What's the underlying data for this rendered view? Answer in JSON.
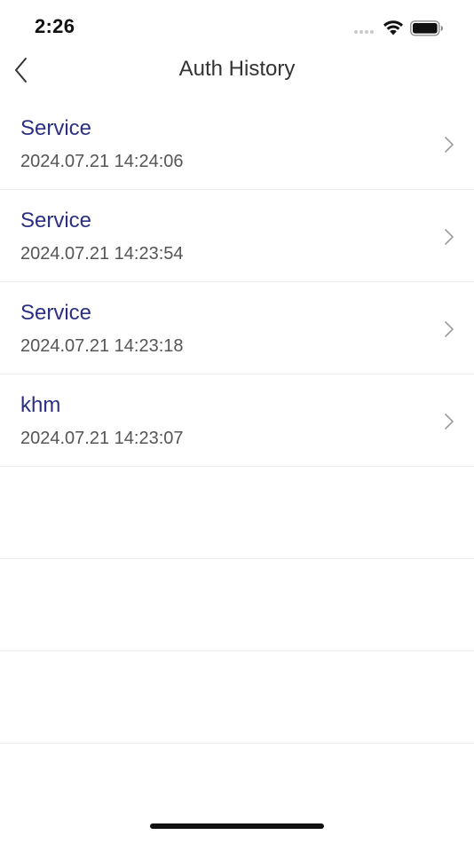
{
  "status_bar": {
    "time": "2:26"
  },
  "nav": {
    "title": "Auth History"
  },
  "history": [
    {
      "title": "Service",
      "datetime": "2024.07.21 14:24:06"
    },
    {
      "title": "Service",
      "datetime": "2024.07.21 14:23:54"
    },
    {
      "title": "Service",
      "datetime": "2024.07.21 14:23:18"
    },
    {
      "title": "khm",
      "datetime": "2024.07.21 14:23:07"
    }
  ],
  "colors": {
    "title_accent": "#2b2f86",
    "date_text": "#555555",
    "divider": "#ececec"
  },
  "icons": {
    "back": "chevron-left-icon",
    "row_disclosure": "chevron-right-icon",
    "wifi": "wifi-icon",
    "battery": "battery-icon"
  }
}
